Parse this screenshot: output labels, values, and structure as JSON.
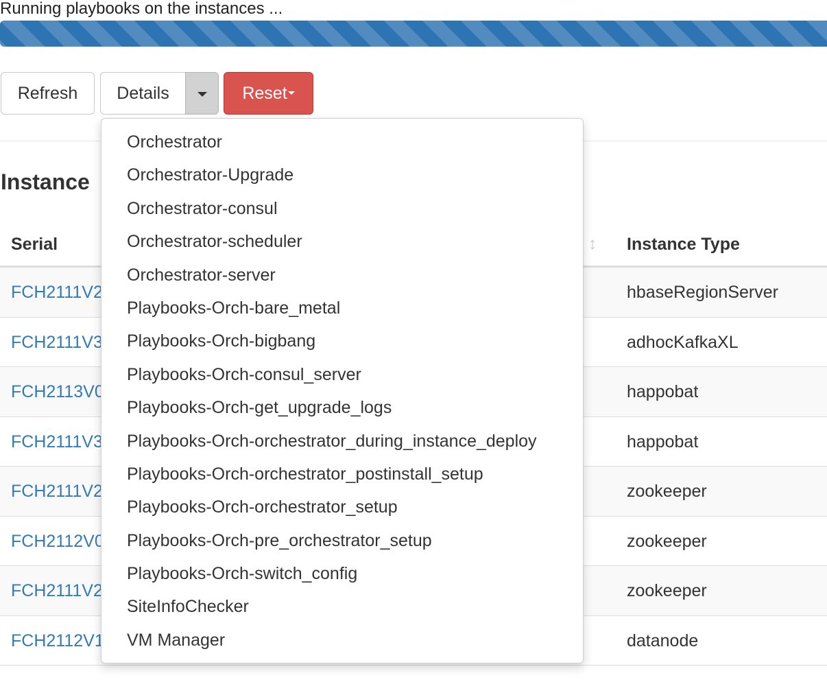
{
  "status": {
    "text": "Running playbooks on the instances ...",
    "progress_percent": 100,
    "progress_color": "#2f74b2"
  },
  "toolbar": {
    "refresh_label": "Refresh",
    "details_label": "Details",
    "reset_label": "Reset",
    "reset_color": "#d9534f"
  },
  "section": {
    "title": "Instance "
  },
  "table": {
    "columns": [
      "Serial",
      "Instance Type"
    ],
    "rows": [
      {
        "serial": "FCH2111V2",
        "type": "hbaseRegionServer"
      },
      {
        "serial": "FCH2111V3",
        "type": "adhocKafkaXL"
      },
      {
        "serial": "FCH2113V0",
        "type": "happobat"
      },
      {
        "serial": "FCH2111V3",
        "type": "happobat"
      },
      {
        "serial": "FCH2111V2",
        "type": "zookeeper"
      },
      {
        "serial": "FCH2112V0",
        "type": "zookeeper"
      },
      {
        "serial": "FCH2111V2",
        "type": "zookeeper"
      },
      {
        "serial": "FCH2112V1",
        "type": "datanode"
      }
    ]
  },
  "dropdown": {
    "items": [
      "Orchestrator",
      "Orchestrator-Upgrade",
      "Orchestrator-consul",
      "Orchestrator-scheduler",
      "Orchestrator-server",
      "Playbooks-Orch-bare_metal",
      "Playbooks-Orch-bigbang",
      "Playbooks-Orch-consul_server",
      "Playbooks-Orch-get_upgrade_logs",
      "Playbooks-Orch-orchestrator_during_instance_deploy",
      "Playbooks-Orch-orchestrator_postinstall_setup",
      "Playbooks-Orch-orchestrator_setup",
      "Playbooks-Orch-pre_orchestrator_setup",
      "Playbooks-Orch-switch_config",
      "SiteInfoChecker",
      "VM Manager"
    ]
  }
}
